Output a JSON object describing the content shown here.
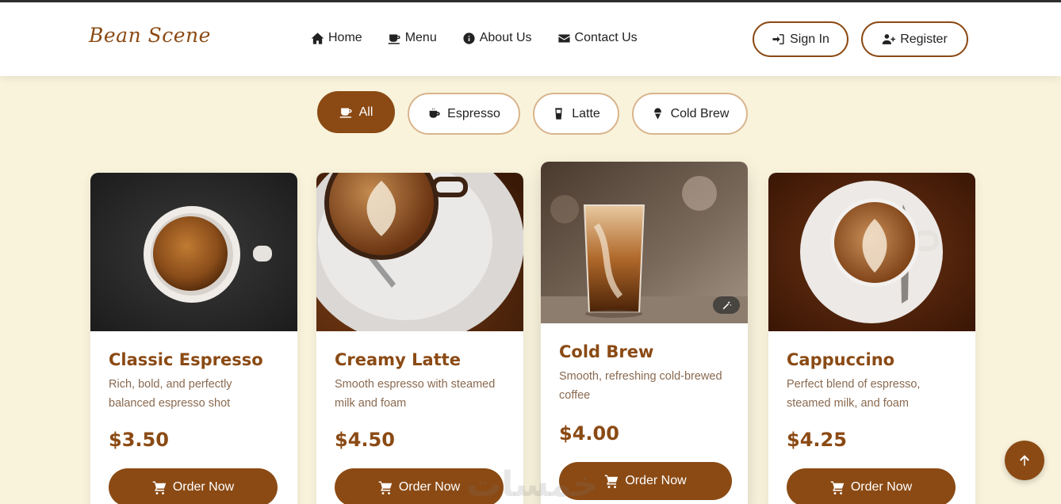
{
  "brand": {
    "logo_text": "Bean Scene"
  },
  "nav": {
    "items": [
      {
        "label": "Home",
        "icon": "home-icon"
      },
      {
        "label": "Menu",
        "icon": "mug-icon"
      },
      {
        "label": "About Us",
        "icon": "info-icon"
      },
      {
        "label": "Contact Us",
        "icon": "envelope-icon"
      }
    ]
  },
  "auth": {
    "signin_label": "Sign In",
    "register_label": "Register"
  },
  "filters": [
    {
      "label": "All",
      "icon": "mug-icon",
      "active": true
    },
    {
      "label": "Espresso",
      "icon": "coffee-cup-icon",
      "active": false
    },
    {
      "label": "Latte",
      "icon": "glass-icon",
      "active": false
    },
    {
      "label": "Cold Brew",
      "icon": "ice-cream-icon",
      "active": false
    }
  ],
  "products": [
    {
      "name": "Classic Espresso",
      "description": "Rich, bold, and perfectly balanced espresso shot",
      "price": "$3.50",
      "button": "Order Now"
    },
    {
      "name": "Creamy Latte",
      "description": "Smooth espresso with steamed milk and foam",
      "price": "$4.50",
      "button": "Order Now"
    },
    {
      "name": "Cold Brew",
      "description": "Smooth, refreshing cold-brewed coffee",
      "price": "$4.00",
      "button": "Order Now"
    },
    {
      "name": "Cappuccino",
      "description": "Perfect blend of espresso, steamed milk, and foam",
      "price": "$4.25",
      "button": "Order Now"
    }
  ],
  "watermark": "خمسات",
  "colors": {
    "accent": "#8b4a14",
    "background": "#f9f3dc",
    "border": "#d9b48c"
  }
}
